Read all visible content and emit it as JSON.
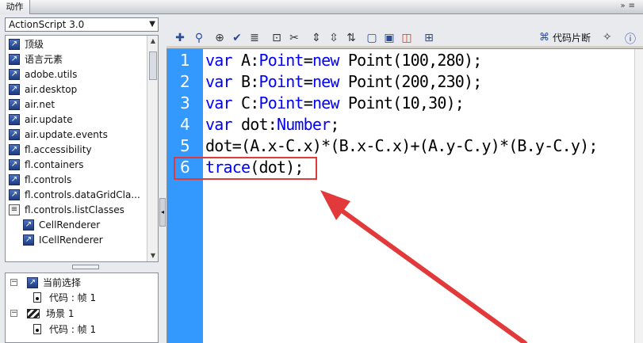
{
  "title": {
    "panel_tab": "动作"
  },
  "language_selector": {
    "value": "ActionScript 3.0"
  },
  "library": {
    "items": [
      {
        "label": "顶级",
        "icon": "package-icon"
      },
      {
        "label": "语言元素",
        "icon": "package-icon"
      },
      {
        "label": "adobe.utils",
        "icon": "package-icon"
      },
      {
        "label": "air.desktop",
        "icon": "package-icon"
      },
      {
        "label": "air.net",
        "icon": "package-icon"
      },
      {
        "label": "air.update",
        "icon": "package-icon"
      },
      {
        "label": "air.update.events",
        "icon": "package-icon"
      },
      {
        "label": "fl.accessibility",
        "icon": "package-icon"
      },
      {
        "label": "fl.containers",
        "icon": "package-icon"
      },
      {
        "label": "fl.controls",
        "icon": "package-icon"
      },
      {
        "label": "fl.controls.dataGridCla...",
        "icon": "package-icon"
      },
      {
        "label": "fl.controls.listClasses",
        "icon": "book-icon"
      },
      {
        "label": "CellRenderer",
        "icon": "class-icon"
      },
      {
        "label": "ICellRenderer",
        "icon": "class-icon"
      }
    ]
  },
  "tree": {
    "current_selection": "当前选择",
    "code_frame_1": "代码 : 帧 1",
    "scene": "场景 1",
    "code_frame_2": "代码 : 帧 1"
  },
  "toolbar": {
    "code_snippets": "代码片断"
  },
  "code": {
    "line_numbers": [
      "1",
      "2",
      "3",
      "4",
      "5",
      "6"
    ],
    "lines": [
      [
        {
          "t": "var",
          "c": "kw"
        },
        {
          "t": " A:",
          "c": "tx"
        },
        {
          "t": "Point",
          "c": "kw"
        },
        {
          "t": "=",
          "c": "tx"
        },
        {
          "t": "new",
          "c": "kw"
        },
        {
          "t": " Point(100,280);",
          "c": "tx"
        }
      ],
      [
        {
          "t": "var",
          "c": "kw"
        },
        {
          "t": " B:",
          "c": "tx"
        },
        {
          "t": "Point",
          "c": "kw"
        },
        {
          "t": "=",
          "c": "tx"
        },
        {
          "t": "new",
          "c": "kw"
        },
        {
          "t": " Point(200,230);",
          "c": "tx"
        }
      ],
      [
        {
          "t": "var",
          "c": "kw"
        },
        {
          "t": " C:",
          "c": "tx"
        },
        {
          "t": "Point",
          "c": "kw"
        },
        {
          "t": "=",
          "c": "tx"
        },
        {
          "t": "new",
          "c": "kw"
        },
        {
          "t": " Point(10,30);",
          "c": "tx"
        }
      ],
      [
        {
          "t": "var",
          "c": "kw"
        },
        {
          "t": " dot:",
          "c": "tx"
        },
        {
          "t": "Number",
          "c": "kw"
        },
        {
          "t": ";",
          "c": "tx"
        }
      ],
      [
        {
          "t": "dot=(A.x-C.x)*(B.x-C.x)+(A.y-C.y)*(B.y-C.y);",
          "c": "tx"
        }
      ],
      [
        {
          "t": "trace",
          "c": "fn"
        },
        {
          "t": "(dot);",
          "c": "tx"
        }
      ]
    ]
  },
  "colors": {
    "gutter": "#3399ff",
    "keyword": "#0000ff",
    "annotation": "#e23a3a"
  }
}
